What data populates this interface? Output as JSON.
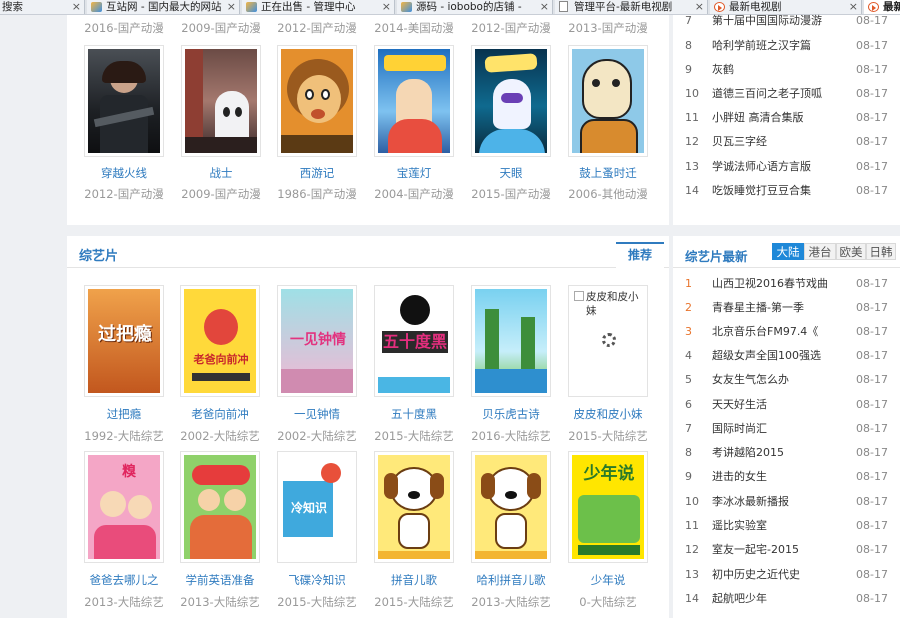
{
  "tabs": [
    {
      "label": "搜索",
      "icon": "none",
      "active": false
    },
    {
      "label": "互站网 - 国内最大的网站",
      "icon": "site-favicon",
      "active": false
    },
    {
      "label": "正在出售 - 管理中心",
      "icon": "site-favicon",
      "active": false
    },
    {
      "label": "源码 - iobobo的店铺 -",
      "icon": "site-favicon",
      "active": false
    },
    {
      "label": "管理平台-最新电视剧",
      "icon": "page-icon",
      "active": false
    },
    {
      "label": "最新电视剧",
      "icon": "play-icon",
      "active": false
    },
    {
      "label": "最新",
      "icon": "play-icon",
      "active": true
    }
  ],
  "top_subs": [
    "2016-国产动漫",
    "2009-国产动漫",
    "2012-国产动漫",
    "2014-美国动漫",
    "2012-国产动漫",
    "2013-国产动漫"
  ],
  "anime": [
    {
      "title": "穿越火线",
      "sub": "2012-国产动漫"
    },
    {
      "title": "战士",
      "sub": "2009-国产动漫"
    },
    {
      "title": "西游记",
      "sub": "1986-国产动漫"
    },
    {
      "title": "宝莲灯",
      "sub": "2004-国产动漫"
    },
    {
      "title": "天眼",
      "sub": "2015-国产动漫"
    },
    {
      "title": "鼓上蚤时迁",
      "sub": "2006-其他动漫"
    }
  ],
  "right_top": [
    {
      "num": "7",
      "text": "第十届中国国际动漫游",
      "date": "08-17"
    },
    {
      "num": "8",
      "text": "哈利学前班之汉字篇",
      "date": "08-17"
    },
    {
      "num": "9",
      "text": "灰鹤",
      "date": "08-17"
    },
    {
      "num": "10",
      "text": "道德三百问之老子顶呱",
      "date": "08-17"
    },
    {
      "num": "11",
      "text": "小胖妞 高清合集版",
      "date": "08-17"
    },
    {
      "num": "12",
      "text": "贝瓦三字经",
      "date": "08-17"
    },
    {
      "num": "13",
      "text": "学诚法师心语方言版",
      "date": "08-17"
    },
    {
      "num": "14",
      "text": "吃饭睡觉打豆豆合集",
      "date": "08-17"
    }
  ],
  "variety": {
    "title": "综艺片",
    "tab": "推荐",
    "row1": [
      {
        "title": "过把瘾",
        "sub": "1992-大陆综艺",
        "poster_text": "过把瘾"
      },
      {
        "title": "老爸向前冲",
        "sub": "2002-大陆综艺",
        "poster_text": "老爸向前冲"
      },
      {
        "title": "一见钟情",
        "sub": "2002-大陆综艺",
        "poster_text": "一见钟情"
      },
      {
        "title": "五十度黑",
        "sub": "2015-大陆综艺",
        "poster_text": "五十度黑"
      },
      {
        "title": "贝乐虎古诗",
        "sub": "2016-大陆综艺",
        "poster_text": ""
      },
      {
        "title": "皮皮和皮小妹",
        "sub": "2015-大陆综艺",
        "poster_text": "皮皮和皮小妹"
      }
    ],
    "row2": [
      {
        "title": "爸爸去哪儿之",
        "sub": "2013-大陆综艺",
        "poster_text": "糗"
      },
      {
        "title": "学前英语准备",
        "sub": "2013-大陆综艺",
        "poster_text": ""
      },
      {
        "title": "飞碟冷知识",
        "sub": "2015-大陆综艺",
        "poster_text": "冷知识"
      },
      {
        "title": "拼音儿歌",
        "sub": "2015-大陆综艺",
        "poster_text": ""
      },
      {
        "title": "哈利拼音儿歌",
        "sub": "2013-大陆综艺",
        "poster_text": ""
      },
      {
        "title": "少年说",
        "sub": "0-大陆综艺",
        "poster_text": "少年说"
      }
    ]
  },
  "variety_latest": {
    "title": "综艺片最新",
    "tabs": [
      "大陆",
      "港台",
      "欧美",
      "日韩"
    ],
    "active_tab": "大陆",
    "items": [
      {
        "num": "1",
        "text": "山西卫视2016春节戏曲",
        "date": "08-17"
      },
      {
        "num": "2",
        "text": "青春星主播-第一季",
        "date": "08-17"
      },
      {
        "num": "3",
        "text": "北京音乐台FM97.4《",
        "date": "08-17"
      },
      {
        "num": "4",
        "text": "超级女声全国100强选",
        "date": "08-17"
      },
      {
        "num": "5",
        "text": "女友生气怎么办",
        "date": "08-17"
      },
      {
        "num": "6",
        "text": "天天好生活",
        "date": "08-17"
      },
      {
        "num": "7",
        "text": "国际时尚汇",
        "date": "08-17"
      },
      {
        "num": "8",
        "text": "考讲越陷2015",
        "date": "08-17"
      },
      {
        "num": "9",
        "text": "进击的女生",
        "date": "08-17"
      },
      {
        "num": "10",
        "text": "李冰冰最新播报",
        "date": "08-17"
      },
      {
        "num": "11",
        "text": "遥比实验室",
        "date": "08-17"
      },
      {
        "num": "12",
        "text": "室友一起宅-2015",
        "date": "08-17"
      },
      {
        "num": "13",
        "text": "初中历史之近代史",
        "date": "08-17"
      },
      {
        "num": "14",
        "text": "起航吧少年",
        "date": "08-17"
      }
    ]
  },
  "colors": {
    "link": "#2f7bbf",
    "hot_rank": "#e8742c",
    "active_tab": "#1e88d8"
  }
}
